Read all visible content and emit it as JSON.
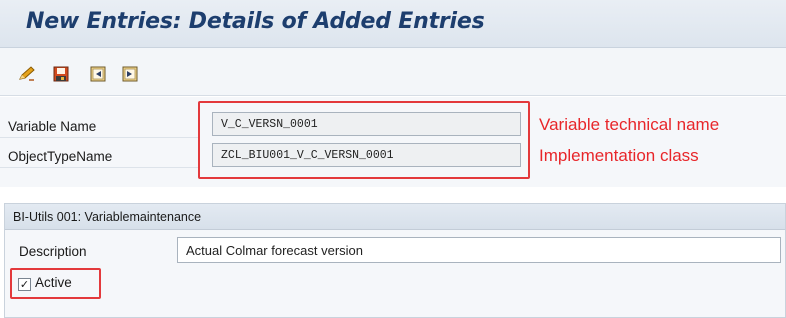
{
  "window": {
    "title": "New Entries: Details of Added Entries"
  },
  "toolbar": {
    "icons": [
      "edit-icon",
      "save-icon",
      "previous-entry-icon",
      "next-entry-icon"
    ]
  },
  "form": {
    "variable_name": {
      "label": "Variable Name",
      "value": "V_C_VERSN_0001"
    },
    "object_type_name": {
      "label": "ObjectTypeName",
      "value": "ZCL_BIU001_V_C_VERSN_0001"
    }
  },
  "annotations": {
    "variable": "Variable technical name",
    "class": "Implementation class",
    "highlight_color": "#e3393c"
  },
  "group": {
    "title": "BI-Utils 001: Variablemaintenance",
    "description": {
      "label": "Description",
      "value": "Actual Colmar forecast version"
    },
    "active": {
      "label": "Active",
      "checked": true
    }
  }
}
